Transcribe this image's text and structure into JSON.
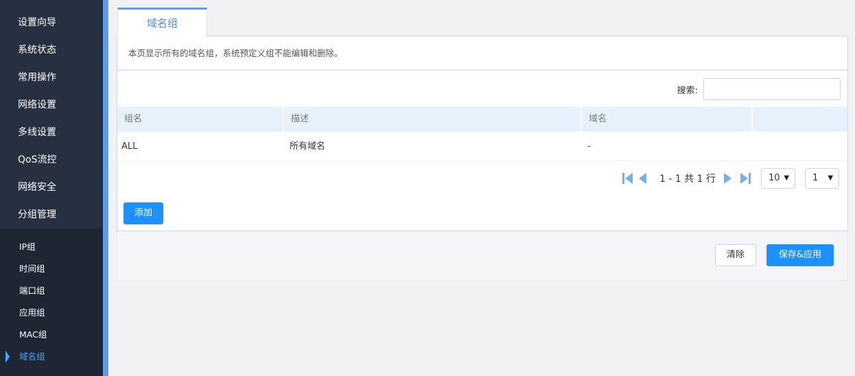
{
  "sidebar": {
    "items": [
      {
        "label": "设置向导"
      },
      {
        "label": "系统状态"
      },
      {
        "label": "常用操作"
      },
      {
        "label": "网络设置"
      },
      {
        "label": "多线设置"
      },
      {
        "label": "QoS流控"
      },
      {
        "label": "网络安全"
      },
      {
        "label": "分组管理"
      }
    ],
    "submenu": [
      {
        "label": "IP组"
      },
      {
        "label": "时间组"
      },
      {
        "label": "端口组"
      },
      {
        "label": "应用组"
      },
      {
        "label": "MAC组"
      },
      {
        "label": "域名组"
      }
    ],
    "active_sub": "域名组"
  },
  "tab": {
    "label": "域名组"
  },
  "description": "本页显示所有的域名组，系统预定义组不能编辑和删除。",
  "search": {
    "label": "搜索:",
    "value": ""
  },
  "table": {
    "headers": [
      "组名",
      "描述",
      "域名",
      ""
    ],
    "rows": [
      {
        "name": "ALL",
        "desc": "所有域名",
        "domain": "-"
      }
    ]
  },
  "pagination": {
    "text": "1 - 1 共 1 行",
    "per_page": "10",
    "page": "1"
  },
  "buttons": {
    "add": "添加",
    "clear": "清除",
    "save": "保存&应用"
  },
  "colors": {
    "sidebar_bg": "#273040",
    "accent": "#1e90ff",
    "active_text": "#4da3ff"
  }
}
